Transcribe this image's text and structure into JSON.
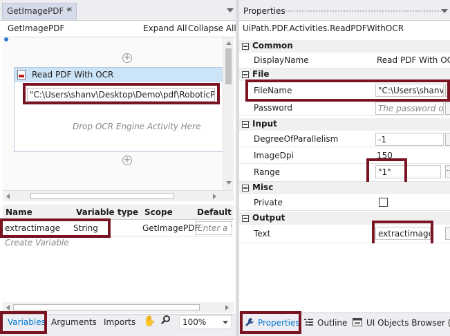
{
  "left_tab": {
    "title": "GetImagePDF *",
    "close": "✕"
  },
  "designer": {
    "breadcrumb": "GetImagePDF",
    "expand_all": "Expand All",
    "collapse_all": "Collapse All"
  },
  "activity": {
    "title": "Read PDF With OCR",
    "filename_value": "\"C:\\Users\\shanv\\Desktop\\Demo\\pdf\\RoboticProc",
    "drop_hint": "Drop OCR Engine Activity Here"
  },
  "variables": {
    "headers": [
      "Name",
      "Variable type",
      "Scope",
      "Default"
    ],
    "rows": [
      {
        "name": "extractimage",
        "type": "String",
        "scope": "GetImagePDF",
        "default_placeholder": "Enter a VB"
      }
    ],
    "create_label": "Create Variable"
  },
  "bottom_tabs": {
    "variables": "Variables",
    "arguments": "Arguments",
    "imports": "Imports",
    "zoom": "100%"
  },
  "properties": {
    "panel_title": "Properties",
    "activity_type": "UiPath.PDF.Activities.ReadPDFWithOCR",
    "categories": {
      "common": "Common",
      "file": "File",
      "input": "Input",
      "misc": "Misc",
      "output": "Output"
    },
    "display_name": {
      "label": "DisplayName",
      "value": "Read PDF With OCR"
    },
    "file_name": {
      "label": "FileName",
      "value": "\"C:\\Users\\shanv\\"
    },
    "password": {
      "label": "Password",
      "placeholder": "The password of :"
    },
    "degree": {
      "label": "DegreeOfParallelism",
      "value": "-1"
    },
    "image_dpi": {
      "label": "ImageDpi",
      "value": "150"
    },
    "range": {
      "label": "Range",
      "value": "\"1\"",
      "ellipsis": "..."
    },
    "private": {
      "label": "Private"
    },
    "text": {
      "label": "Text",
      "value": "extractimage"
    }
  },
  "right_tabs": {
    "properties": "Properties",
    "outline": "Outline",
    "ui_objects": "UI Objects Browser (Ex"
  },
  "colors": {
    "highlight": "#7b1422",
    "selected_activity": "#cce4f7",
    "tab_active": "#0078d7"
  }
}
